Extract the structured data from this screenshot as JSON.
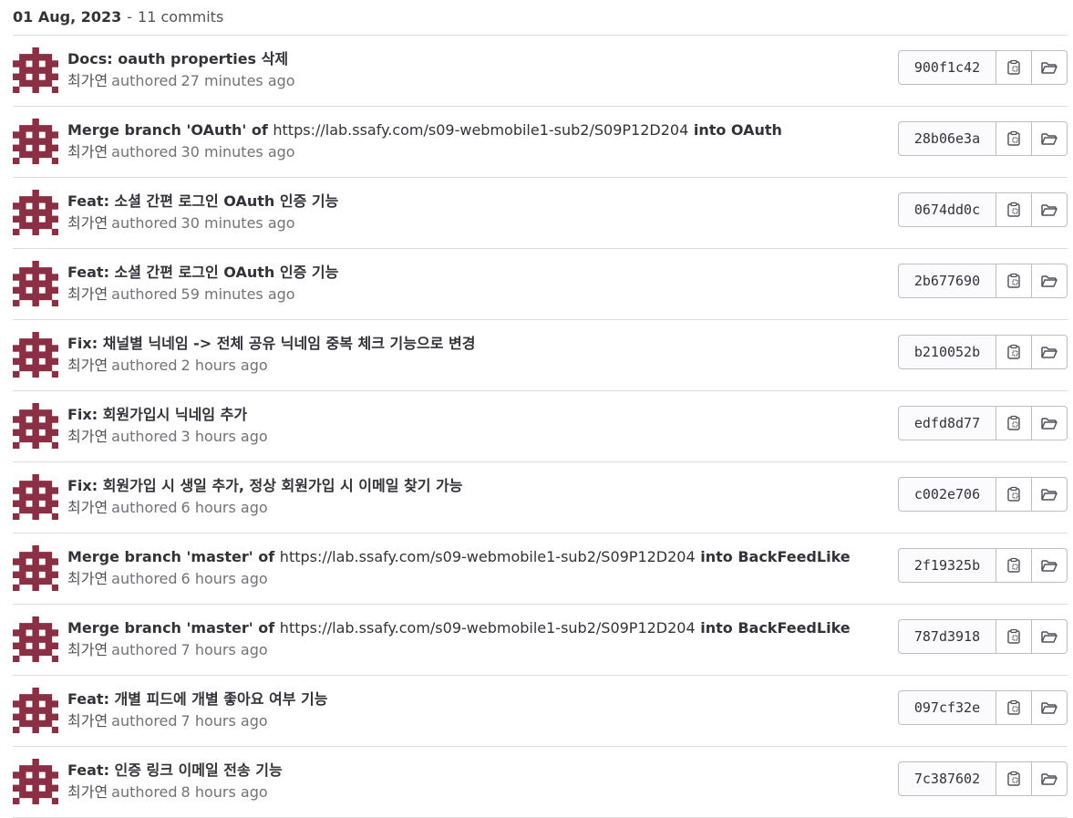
{
  "header": {
    "date": "01 Aug, 2023",
    "separator": "-",
    "count": "11 commits"
  },
  "icons": {
    "copy": "copy-to-clipboard-icon",
    "browse": "folder-open-icon"
  },
  "colors": {
    "avatar": "#8b2f45"
  },
  "commits": [
    {
      "title_parts": [
        {
          "t": "Docs: oauth properties 삭제",
          "s": "bold"
        }
      ],
      "author": "최가연",
      "authored": "authored",
      "time": "27 minutes ago",
      "sha": "900f1c42"
    },
    {
      "title_parts": [
        {
          "t": "Merge branch 'OAuth' of ",
          "s": "bold"
        },
        {
          "t": "https://lab.ssafy.com/s09-webmobile1-sub2/S09P12D204",
          "s": "link"
        },
        {
          "t": " into OAuth",
          "s": "bold"
        }
      ],
      "author": "최가연",
      "authored": "authored",
      "time": "30 minutes ago",
      "sha": "28b06e3a"
    },
    {
      "title_parts": [
        {
          "t": "Feat: 소셜 간편 로그인 OAuth 인증 기능",
          "s": "bold"
        }
      ],
      "author": "최가연",
      "authored": "authored",
      "time": "30 minutes ago",
      "sha": "0674dd0c"
    },
    {
      "title_parts": [
        {
          "t": "Feat: 소셜 간편 로그인 OAuth 인증 기능",
          "s": "bold"
        }
      ],
      "author": "최가연",
      "authored": "authored",
      "time": "59 minutes ago",
      "sha": "2b677690"
    },
    {
      "title_parts": [
        {
          "t": "Fix: 채널별 닉네임 -> 전체 공유 닉네임 중복 체크 기능으로 변경",
          "s": "bold"
        }
      ],
      "author": "최가연",
      "authored": "authored",
      "time": "2 hours ago",
      "sha": "b210052b"
    },
    {
      "title_parts": [
        {
          "t": "Fix: 회원가입시 닉네임 추가",
          "s": "bold"
        }
      ],
      "author": "최가연",
      "authored": "authored",
      "time": "3 hours ago",
      "sha": "edfd8d77"
    },
    {
      "title_parts": [
        {
          "t": "Fix: 회원가입 시 생일 추가, 정상 회원가입 시 이메일 찾기 가능",
          "s": "bold"
        }
      ],
      "author": "최가연",
      "authored": "authored",
      "time": "6 hours ago",
      "sha": "c002e706"
    },
    {
      "title_parts": [
        {
          "t": "Merge branch 'master' of ",
          "s": "bold"
        },
        {
          "t": "https://lab.ssafy.com/s09-webmobile1-sub2/S09P12D204",
          "s": "link"
        },
        {
          "t": " into BackFeedLike",
          "s": "bold"
        }
      ],
      "author": "최가연",
      "authored": "authored",
      "time": "6 hours ago",
      "sha": "2f19325b"
    },
    {
      "title_parts": [
        {
          "t": "Merge branch 'master' of ",
          "s": "bold"
        },
        {
          "t": "https://lab.ssafy.com/s09-webmobile1-sub2/S09P12D204",
          "s": "link"
        },
        {
          "t": " into BackFeedLike",
          "s": "bold"
        }
      ],
      "author": "최가연",
      "authored": "authored",
      "time": "7 hours ago",
      "sha": "787d3918"
    },
    {
      "title_parts": [
        {
          "t": "Feat: 개별 피드에 개별 좋아요 여부 기능",
          "s": "bold"
        }
      ],
      "author": "최가연",
      "authored": "authored",
      "time": "7 hours ago",
      "sha": "097cf32e"
    },
    {
      "title_parts": [
        {
          "t": "Feat: 인증 링크 이메일 전송 기능",
          "s": "bold"
        }
      ],
      "author": "최가연",
      "authored": "authored",
      "time": "8 hours ago",
      "sha": "7c387602"
    }
  ]
}
